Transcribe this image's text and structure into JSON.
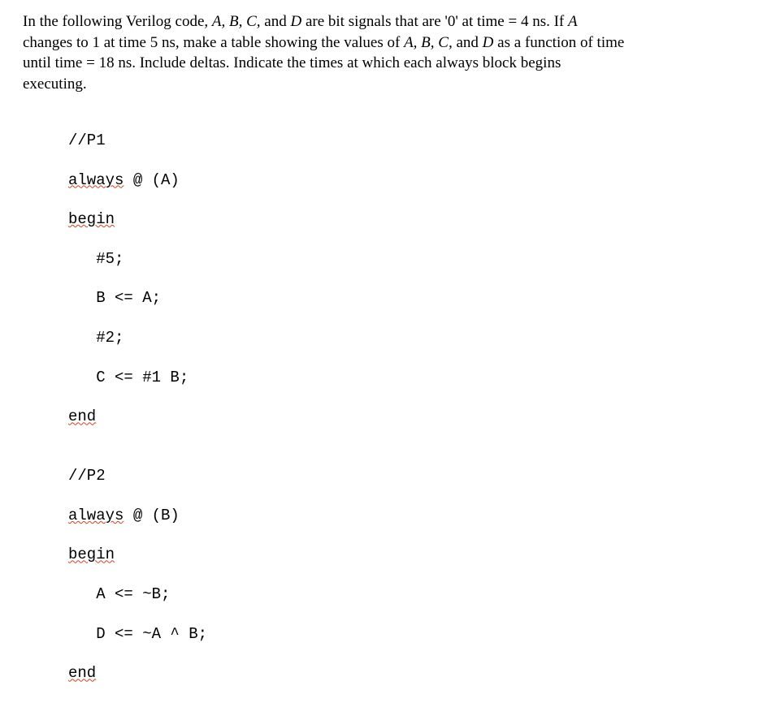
{
  "problem": {
    "pre1": "In the following Verilog code, ",
    "abcd": "A, B, C,",
    "and1": " and ",
    "d1": "D",
    "mid1": " are bit signals that are '0' at time = 4 ns. If ",
    "a1": "A",
    "line2a": "changes to 1 at time 5 ns, make a table showing the values of ",
    "abcd2": "A, B, C,",
    "and2": " and ",
    "d2": "D",
    "line2b": " as a function of time",
    "line3": "until time = 18 ns. Include deltas. Indicate the times at which each always block begins",
    "line4": "executing."
  },
  "code": {
    "c1": "//P1",
    "c2a": "always",
    "c2b": " @ (A)",
    "c3": "begin",
    "c4": "#5;",
    "c5": "B <= A;",
    "c6": "#2;",
    "c7": "C <= #1 B;",
    "c8": "end",
    "blank1": "",
    "c9": "//P2",
    "c10a": "always",
    "c10b": " @ (B)",
    "c11": "begin",
    "c12": "A <= ~B;",
    "c13": "D <= ~A ^ B;",
    "c14": "end"
  }
}
